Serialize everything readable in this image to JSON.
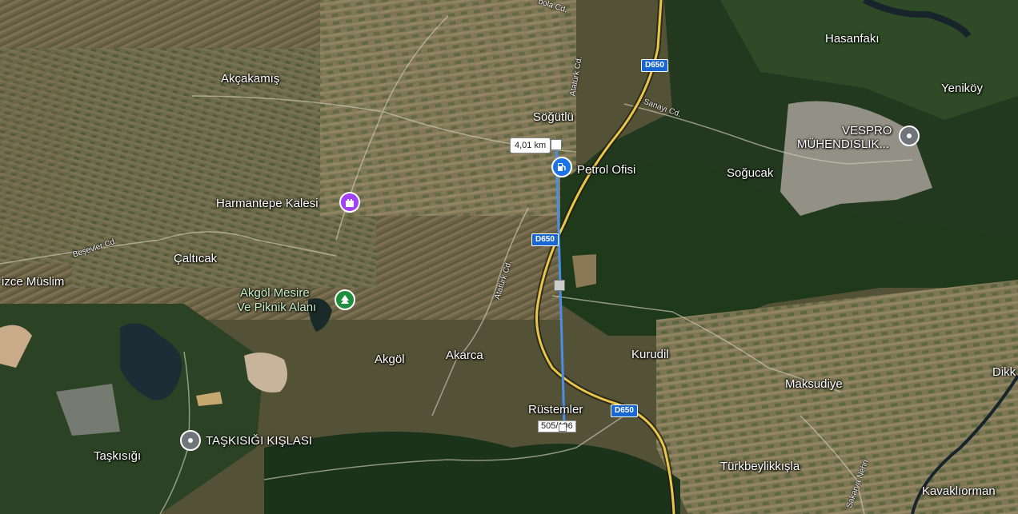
{
  "map": {
    "place_labels": {
      "hasanfaki": "Hasanfakı",
      "yenikoy": "Yeniköy",
      "akcakamis": "Akçakamış",
      "sogutlu": "Söğütlü",
      "sogucak": "Soğucak",
      "harmantepe": "Harmantepe Kalesi",
      "caltıcak": "Çaltıcak",
      "izce_muslim": "izce Müslim",
      "akgol_mesire_1": "Akgöl Mesire",
      "akgol_mesire_2": "Ve Piknik Alanı",
      "akgol": "Akgöl",
      "akarca": "Akarca",
      "kurudil": "Kurudil",
      "maksudiye": "Maksudiye",
      "dikk": "Dikk",
      "rustemler": "Rüstemler",
      "taskisigi_kislasi": "TAŞKISIĞI KIŞLASI",
      "taskisigi": "Taşkısığı",
      "turkbeylikkisla": "Türkbeylikkışla",
      "kavaklıorman": "Kavaklıorman",
      "vespro_1": "VESPRO",
      "vespro_2": "MÜHENDISLIK...",
      "petrol_ofisi": "Petrol Ofisi"
    },
    "road_labels": {
      "sanayi": "Sanayi Cd.",
      "ataturk_top": "Atatürk Cd.",
      "ataturk_mid": "Atatürk Cd.",
      "besevler": "Beşevler Cd.",
      "bola": "bola Cd.",
      "sakarya": "Sakarya Nehri"
    },
    "shields": {
      "d650_top": "D650",
      "d650_mid": "D650",
      "d650_bottom": "D650"
    },
    "measurement": {
      "distance": "4,01 km",
      "coordinate": "505/196"
    },
    "icons": {
      "castle": "castle-icon",
      "tree": "tree-icon",
      "fuel": "fuel-station-icon",
      "pin": "location-pin-icon"
    },
    "colors": {
      "measure_line": "#4a8ee8",
      "shield_bg": "#1967d2",
      "castle_pin": "#a142f4",
      "park_pin": "#1e8e3e",
      "fuel_pin": "#1a73e8",
      "gray_pin": "#70757a",
      "highway": "#e9c64a"
    }
  }
}
